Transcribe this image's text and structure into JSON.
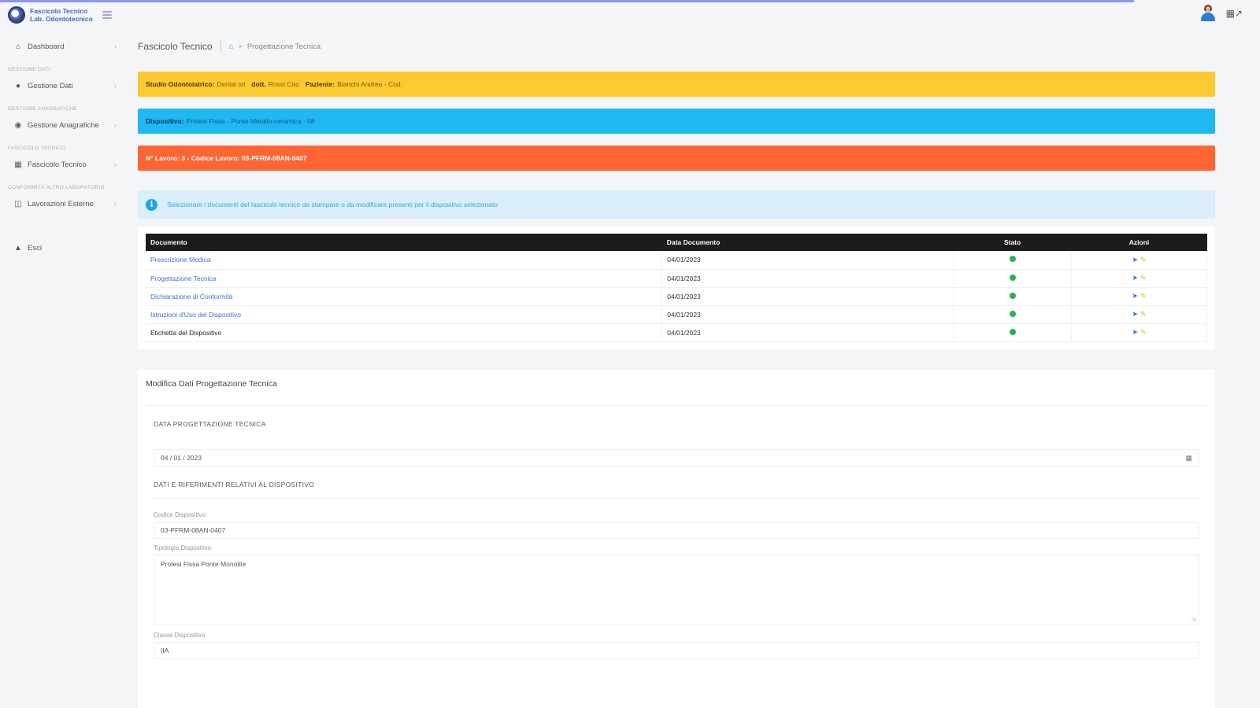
{
  "app": {
    "brand_line1": "Fascicolo Tecnico",
    "brand_line2": "Lab. Odontotecnico"
  },
  "sidebar": {
    "items": [
      {
        "label": "Dashboard",
        "icon": "home-icon",
        "section": ""
      },
      {
        "label": "Gestione Dati",
        "icon": "user-icon",
        "section": "GESTIONE DATI"
      },
      {
        "label": "Gestione Anagrafiche",
        "icon": "users-icon",
        "section": "GESTIONE ANAGRAFICHE"
      },
      {
        "label": "Fascicolo Tecnico",
        "icon": "folder-icon",
        "section": "FASCICOLO TECNICO"
      },
      {
        "label": "Lavorazioni Esterne",
        "icon": "book-icon",
        "section": "CONFORMITÀ ALTRO LABORATORIO"
      }
    ],
    "logout_label": "Esci"
  },
  "breadcrumb": {
    "title": "Fascicolo Tecnico",
    "current": "Progettazione Tecnica"
  },
  "alerts": {
    "studio_label": "Studio Odontoiatrico:",
    "studio_value": "Dental srl",
    "dott_label": "dott.",
    "dott_value": "Rossi Ciro",
    "paziente_label": "Paziente:",
    "paziente_value": "Bianchi Andrea - Cod.",
    "dispositivo_label": "Dispositivo:",
    "dispositivo_value": "Protesi Fissa - Ponte Metallo-ceramica - 08",
    "lavoro_text": "N° Lavoro: 3 - Codice Lavoro: 03-PFRM-08AN-0407"
  },
  "info": {
    "text": "Selezionare i documenti del fascicolo tecnico da stampare o da modificare presenti per il dispositivo selezionato"
  },
  "table": {
    "headers": [
      "Documento",
      "Data Documento",
      "Stato",
      "Azioni"
    ],
    "rows": [
      {
        "documento": "Prescrizione Medica",
        "data": "04/01/2023",
        "link": true
      },
      {
        "documento": "Progettazione Tecnica",
        "data": "04/01/2023",
        "link": true
      },
      {
        "documento": "Dichiarazione di Conformità",
        "data": "04/01/2023",
        "link": true
      },
      {
        "documento": "Istruzioni d'Uso del Dispositivo",
        "data": "04/01/2023",
        "link": true
      },
      {
        "documento": "Etichetta del Dispositivo",
        "data": "04/01/2023",
        "link": false
      }
    ]
  },
  "form": {
    "title": "Modifica Dati Progettazione Tecnica",
    "section1": "DATA PROGETTAZIONE TECNICA",
    "date_value": "04 / 01 / 2023",
    "section2": "DATI E RIFERIMENTI RELATIVI AL DISPOSITIVO",
    "codice_label": "Codice Dispositivo",
    "codice_value": "03-PFRM-08AN-0407",
    "tipologia_label": "Tipologia Dispositivo",
    "tipologia_value": "Protesi Fissa Ponte Monolite",
    "classe_label": "Classe Dispositivo",
    "classe_value": "IIA"
  },
  "colors": {
    "yellow": "#fdc930",
    "blue": "#1fb8f3",
    "orange": "#fe6532",
    "status_ok": "#29b34a",
    "link": "#3c6fe0"
  }
}
